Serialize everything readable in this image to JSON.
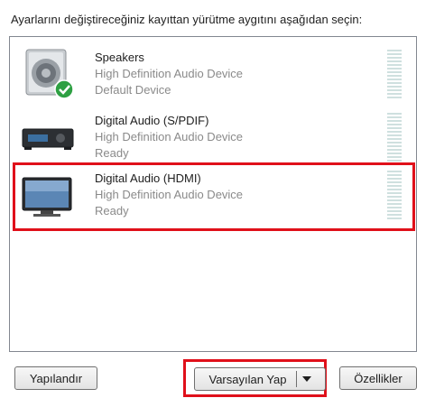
{
  "instruction": "Ayarlarını değiştireceğiniz kayıttan yürütme aygıtını aşağıdan seçin:",
  "devices": [
    {
      "name": "Speakers",
      "description": "High Definition Audio Device",
      "status": "Default Device",
      "icon": "speaker-icon",
      "badge": "default-check-icon",
      "selected": false
    },
    {
      "name": "Digital Audio (S/PDIF)",
      "description": "High Definition Audio Device",
      "status": "Ready",
      "icon": "receiver-icon",
      "selected": false
    },
    {
      "name": "Digital Audio (HDMI)",
      "description": "High Definition Audio Device",
      "status": "Ready",
      "icon": "tv-icon",
      "selected": true
    }
  ],
  "buttons": {
    "configure": "Yapılandır",
    "set_default": "Varsayılan Yap",
    "properties": "Özellikler"
  },
  "colors": {
    "highlight": "#e0101a",
    "meter": "#cfe0df",
    "check": "#2ea043"
  }
}
